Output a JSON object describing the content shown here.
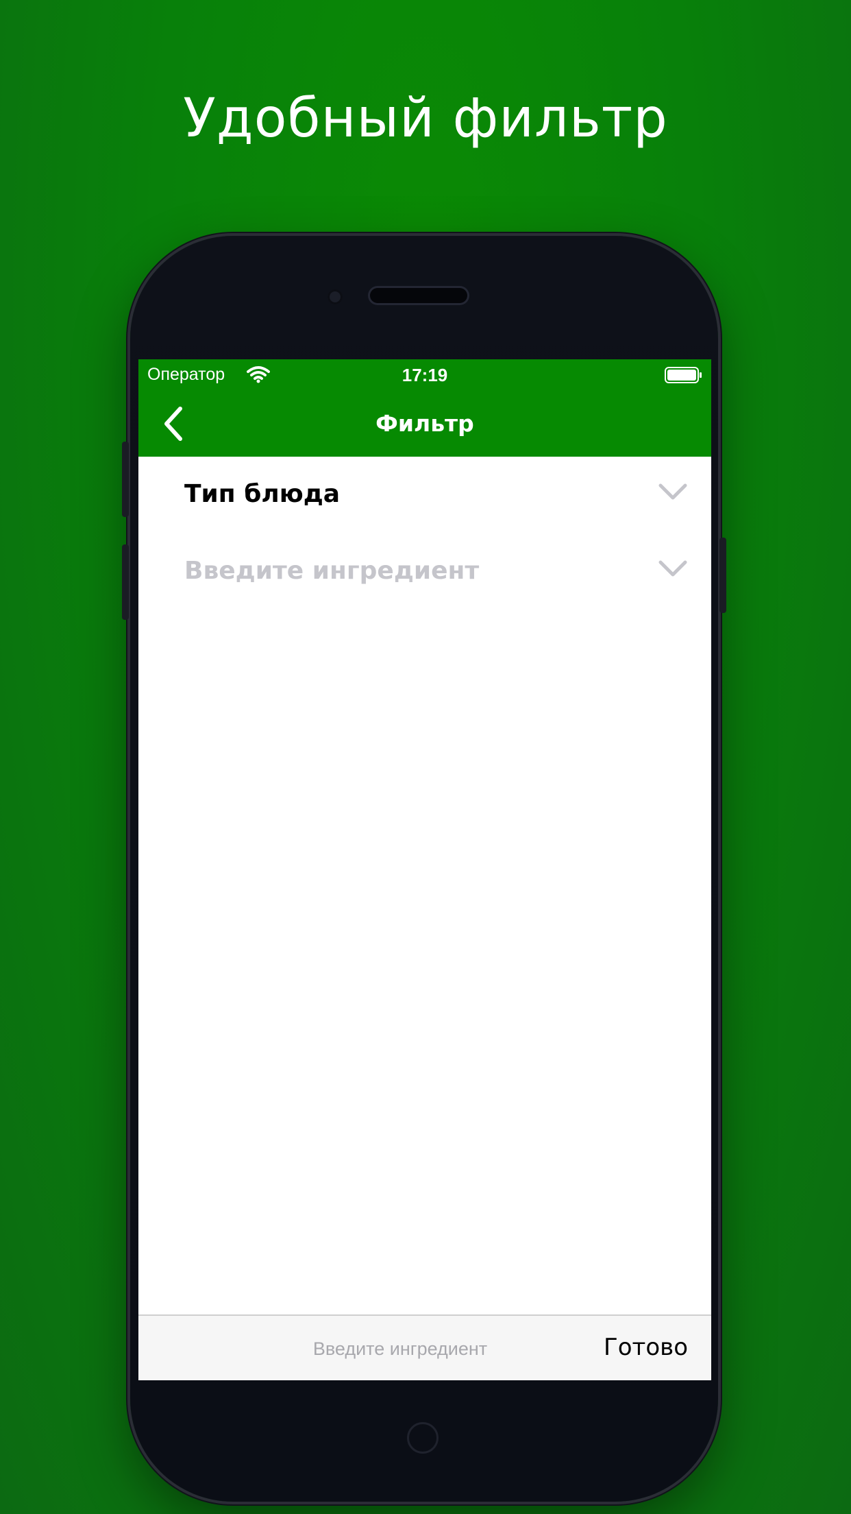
{
  "promo": {
    "headline": "Удобный фильтр"
  },
  "status_bar": {
    "carrier": "Оператор",
    "time": "17:19",
    "wifi_icon": "wifi-icon",
    "battery_icon": "battery-full-icon"
  },
  "nav": {
    "back_icon": "chevron-left-icon",
    "title": "Фильтр"
  },
  "filters": [
    {
      "label": "Тип блюда",
      "icon": "chevron-down-icon"
    },
    {
      "label": "Введите ингредиент",
      "icon": "chevron-down-icon"
    }
  ],
  "input_toolbar": {
    "placeholder": "Введите ингредиент",
    "value": "",
    "done_label": "Готово"
  },
  "colors": {
    "background": "#088506",
    "nav_bar": "#068a02",
    "placeholder_text": "#c5c5cb",
    "phone_body": "#0e1119"
  }
}
